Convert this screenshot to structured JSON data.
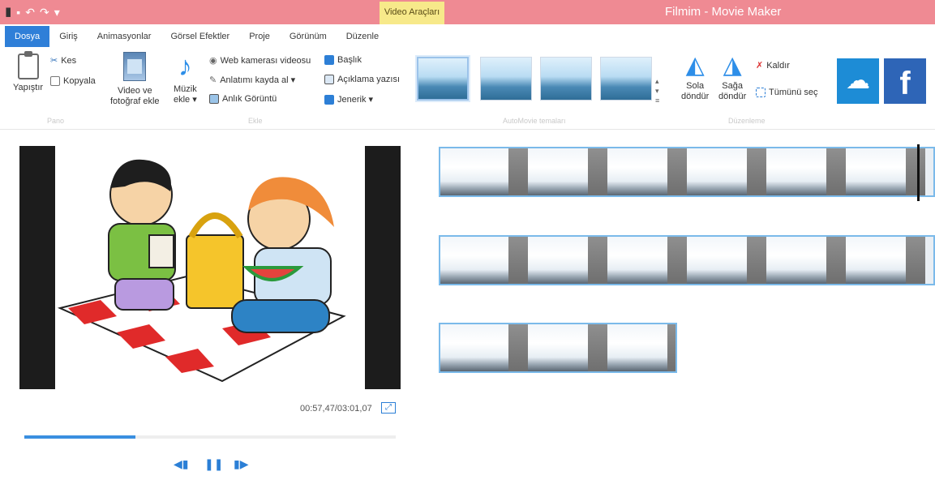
{
  "titlebar": {
    "context_tab": "Video Araçları",
    "window_title": "Filmim - Movie Maker"
  },
  "tabs": [
    "Dosya",
    "Giriş",
    "Animasyonlar",
    "Görsel Efektler",
    "Proje",
    "Görünüm",
    "Düzenle"
  ],
  "ribbon": {
    "clipboard": {
      "paste": "Yapıştır",
      "cut": "Kes",
      "copy": "Kopyala",
      "group_label": "Pano"
    },
    "add": {
      "add_video_line1": "Video ve",
      "add_video_line2": "fotoğraf ekle",
      "add_music_line1": "Müzik",
      "add_music_line2": "ekle ▾",
      "webcam": "Web kamerası videosu",
      "narration": "Anlatımı kayda al ▾",
      "snapshot": "Anlık Görüntü",
      "title": "Başlık",
      "caption": "Açıklama yazısı",
      "credits": "Jenerik ▾",
      "group_label": "Ekle"
    },
    "automovie": {
      "group_label": "AutoMovie temaları"
    },
    "editing": {
      "rotate_left_line1": "Sola",
      "rotate_left_line2": "döndür",
      "rotate_right_line1": "Sağa",
      "rotate_right_line2": "döndür",
      "remove": "Kaldır",
      "select_all": "Tümünü seç",
      "group_label": "Düzenleme"
    }
  },
  "preview": {
    "time": "00:57,47/03:01,07",
    "progress": 0.3
  },
  "colors": {
    "titlebar": "#ef8a93",
    "accent": "#2f7fd8",
    "context_tab": "#f7e98a"
  }
}
